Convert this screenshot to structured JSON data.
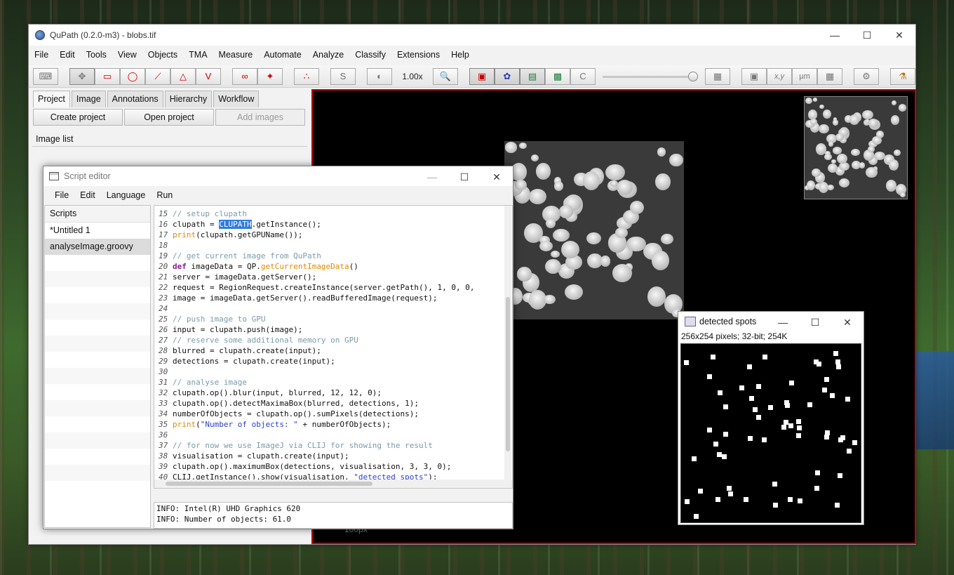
{
  "main_window": {
    "title": "QuPath (0.2.0-m3) - blobs.tif",
    "menus": [
      "File",
      "Edit",
      "Tools",
      "View",
      "Objects",
      "TMA",
      "Measure",
      "Automate",
      "Analyze",
      "Classify",
      "Extensions",
      "Help"
    ],
    "toolbar": {
      "zoom": "1.00x",
      "letter_s": "S",
      "letter_c": "C",
      "xy": "x,y",
      "um": "µm"
    },
    "left_tabs": [
      "Project",
      "Image",
      "Annotations",
      "Hierarchy",
      "Workflow"
    ],
    "project_buttons": [
      "Create project",
      "Open project",
      "Add images"
    ],
    "image_list_label": "Image list",
    "scalebar_label": "100px"
  },
  "script_editor": {
    "title": "Script editor",
    "menus": [
      "File",
      "Edit",
      "Language",
      "Run"
    ],
    "scripts_header": "Scripts",
    "scripts": [
      "*Untitled 1",
      "analyseImage.groovy"
    ],
    "console": [
      "INFO: Intel(R) UHD Graphics 620",
      "INFO: Number of objects: 61.0"
    ]
  },
  "spots_window": {
    "title": "detected spots",
    "info": "256x254 pixels; 32-bit; 254K"
  },
  "icons": {
    "app": "qupath-logo-icon",
    "close": "close-icon",
    "maximize": "maximize-icon",
    "minimize": "minimize-icon"
  }
}
